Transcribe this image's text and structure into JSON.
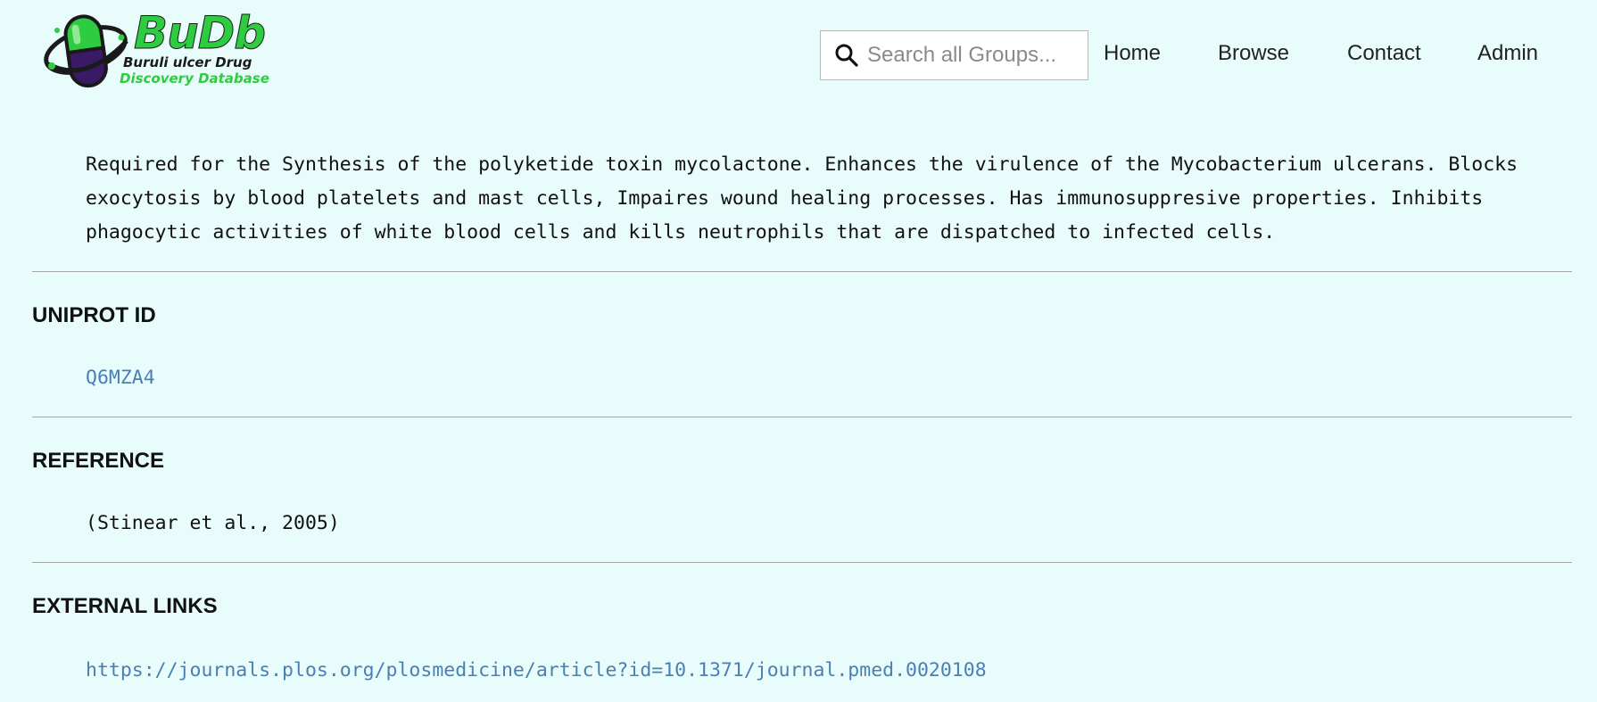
{
  "logo": {
    "title": "BuDb",
    "line1": "Buruli ulcer Drug",
    "line2": "Discovery Database",
    "colors": {
      "green": "#2ecc40",
      "dark": "#1a1a1a",
      "purple": "#3a1a66"
    }
  },
  "search": {
    "placeholder": "Search all Groups...",
    "value": ""
  },
  "nav": {
    "home": "Home",
    "browse": "Browse",
    "contact": "Contact",
    "admin": "Admin"
  },
  "description": "Required for the Synthesis of the polyketide toxin mycolactone. Enhances the virulence of the Mycobacterium ulcerans. Blocks exocytosis by blood platelets and mast cells, Impaires wound healing processes. Has immunosuppresive properties. Inhibits phagocytic activities of white blood cells and kills neutrophils that are dispatched to infected cells.",
  "sections": {
    "uniprot": {
      "heading": "UNIPROT ID",
      "value": "Q6MZA4"
    },
    "reference": {
      "heading": "REFERENCE",
      "value": "(Stinear et al., 2005)"
    },
    "external_links": {
      "heading": "EXTERNAL LINKS",
      "value": "https://journals.plos.org/plosmedicine/article?id=10.1371/journal.pmed.0020108"
    }
  },
  "colors": {
    "page_background": "#e8fcfc",
    "link": "#4a7fb5",
    "divider": "#a5a5a5"
  }
}
